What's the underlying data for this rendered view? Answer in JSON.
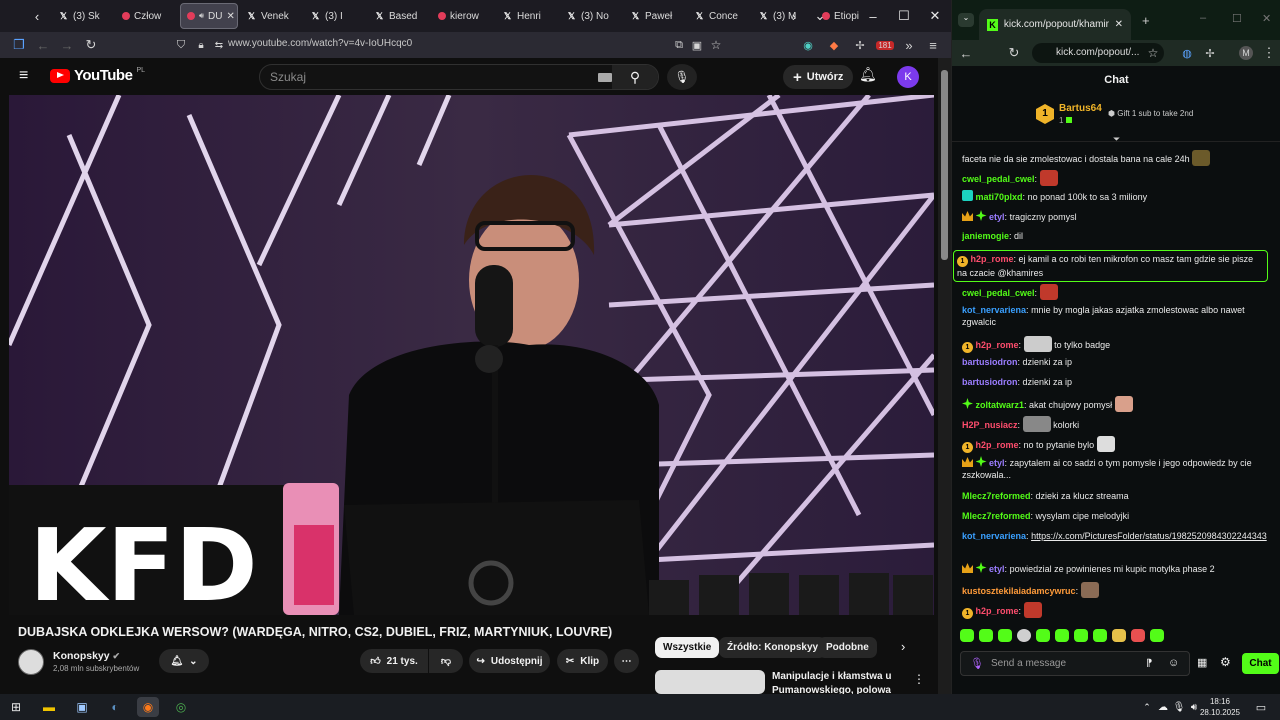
{
  "firefox": {
    "tabs": [
      {
        "icon": "x",
        "label": "(3) Sk"
      },
      {
        "icon": "yt",
        "label": "Człow"
      },
      {
        "icon": "yt",
        "label": "DU",
        "active": true
      },
      {
        "icon": "x",
        "label": "Venek"
      },
      {
        "icon": "x",
        "label": "(3) I"
      },
      {
        "icon": "x",
        "label": "Based"
      },
      {
        "icon": "yt",
        "label": "kierow"
      },
      {
        "icon": "x",
        "label": "Henri"
      },
      {
        "icon": "x",
        "label": "(3) No"
      },
      {
        "icon": "x",
        "label": "Paweł"
      },
      {
        "icon": "x",
        "label": "Conce"
      },
      {
        "icon": "x",
        "label": "(3) M"
      },
      {
        "icon": "yt",
        "label": "Etiopi"
      }
    ],
    "url": "www.youtube.com/watch?v=4v-IoUHcqc0",
    "notif_count": "181"
  },
  "youtube": {
    "logo_text": "YouTube",
    "country": "PL",
    "search_placeholder": "Szukaj",
    "create_label": "Utwórz",
    "avatar_letter": "K",
    "video_overlay_text": "KFD",
    "video_title": "DUBAJSKA ODKLEJKA WERSOW? (WARDĘGA, NITRO, CS2, DUBIEL, FRIZ, MARTYNIUK, LOUVRE)",
    "channel_name": "Konopskyy",
    "subscribers": "2,08 mln subskrybentów",
    "likes": "21 tys.",
    "share_label": "Udostępnij",
    "clip_label": "Klip",
    "chips": [
      "Wszystkie",
      "Źródło: Konopskyy",
      "Podobne"
    ],
    "reco_title_line1": "Manipulacje i kłamstwa u",
    "reco_title_line2": "Pumanowskiego, polowa"
  },
  "chrome": {
    "tab_title": "kick.com/popout/khamires/cha",
    "url": "kick.com/popout/..."
  },
  "chat": {
    "header": "Chat",
    "pinned_user": "Bartus64",
    "pinned_rank": "1",
    "gift_text": "Gift 1 sub to take 2nd",
    "messages": [
      {
        "user": "",
        "text": "faceta nie da sie zmolestowac i dostala bana na cale 24h"
      },
      {
        "user": "cwel_pedal_cwel",
        "color": "#53fc18",
        "text": ""
      },
      {
        "user": "mati70plxd",
        "color": "#53fc18",
        "text": "no ponad 100k to sa 3 miliony"
      },
      {
        "user": "etyl",
        "color": "#9b7dff",
        "text": "tragiczny pomysl"
      },
      {
        "user": "janiemogie",
        "color": "#53fc18",
        "text": "dil"
      },
      {
        "user": "h2p_rome",
        "color": "#ff4d6d",
        "text": "ej kamil a co robi ten mikrofon co masz tam gdzie sie pisze na czacie @khamires"
      },
      {
        "user": "cwel_pedal_cwel",
        "color": "#53fc18",
        "text": ""
      },
      {
        "user": "kot_nervariena",
        "color": "#3aa0ff",
        "text": "mnie by mogla jakas azjatka zmolestowac albo nawet zgwalcic"
      },
      {
        "user": "h2p_rome",
        "color": "#ff4d6d",
        "text": "to tylko badge"
      },
      {
        "user": "bartusiodron",
        "color": "#9b7dff",
        "text": "dzienki za ip"
      },
      {
        "user": "bartusiodron",
        "color": "#9b7dff",
        "text": "dzienki za ip"
      },
      {
        "user": "zoltatwarz1",
        "color": "#53fc18",
        "text": "akat chujowy pomysł"
      },
      {
        "user": "H2P_nusiacz",
        "color": "#ff4d6d",
        "text": "kolorki"
      },
      {
        "user": "h2p_rome",
        "color": "#ff4d6d",
        "text": "no to pytanie bylo"
      },
      {
        "user": "etyl",
        "color": "#9b7dff",
        "text": "zapytalem ai co sadzi o tym pomysle i jego odpowiedz by cie zszkowala..."
      },
      {
        "user": "Mlecz7reformed",
        "color": "#53fc18",
        "text": "dzieki za klucz streama"
      },
      {
        "user": "Mlecz7reformed",
        "color": "#53fc18",
        "text": "wysylam cipe melodyjki"
      },
      {
        "user": "kot_nervariena",
        "color": "#3aa0ff",
        "text": "https://x.com/PicturesFolder/status/1982520984302244343"
      },
      {
        "user": "etyl",
        "color": "#9b7dff",
        "text": "powiedzial ze powinienes mi kupic motylka phase 2"
      },
      {
        "user": "kustosztekilaiadamcywruc",
        "color": "#ff9b3a",
        "text": ""
      },
      {
        "user": "h2p_rome",
        "color": "#ff4d6d",
        "text": ""
      }
    ],
    "input_placeholder": "Send a message",
    "send_label": "Chat"
  },
  "taskbar": {
    "time": "18:16",
    "date": "28.10.2025"
  }
}
